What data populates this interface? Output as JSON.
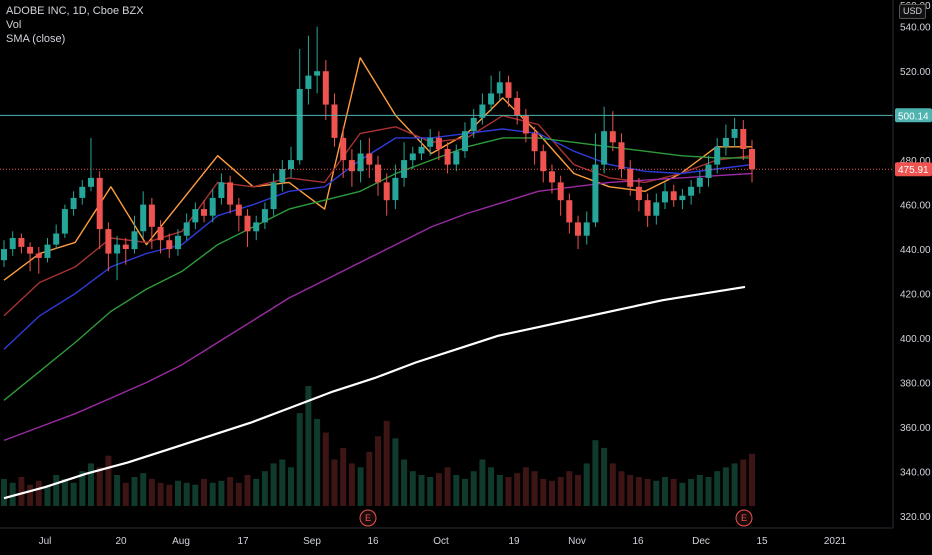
{
  "legend": {
    "symbol": "ADOBE INC, 1D, Cboe BZX",
    "vol": "Vol",
    "sma": "SMA (close)"
  },
  "currency_badge": "USD",
  "colors": {
    "background": "#000000",
    "up": "#26a69a",
    "down": "#ef5350",
    "sma_fast": "#ff9e3d",
    "sma_mid": "#a83232",
    "sma_blue": "#2f3bd8",
    "sma_green": "#2e9b3a",
    "sma_purple": "#9b2aa3",
    "sma_slow": "#ffffff",
    "hline": "#4fb4b0"
  },
  "chart_data": {
    "type": "candlestick",
    "title": "ADOBE INC, 1D, Cboe BZX",
    "xlabel": "",
    "ylabel": "",
    "ylim": [
      311,
      552
    ],
    "y_ticks": [
      320,
      340,
      360,
      380,
      400,
      420,
      440,
      460,
      480,
      500,
      520,
      540
    ],
    "x_ticks": [
      "Jul",
      "20",
      "Aug",
      "17",
      "Sep",
      "16",
      "Oct",
      "19",
      "Nov",
      "16",
      "Dec",
      "15",
      "2021"
    ],
    "grid": false,
    "horizontal_line": 500.14,
    "price_labels": [
      {
        "value": 500.14,
        "text": "500.14",
        "color": "#4fb4b0"
      },
      {
        "value": 475.91,
        "text": "475.91",
        "color": "#ef5350"
      }
    ],
    "top_cut_label": "560.00",
    "earnings_markers": [
      {
        "label": "E",
        "date": "Sep 15"
      },
      {
        "label": "E",
        "date": "Dec 10"
      }
    ],
    "candles": [
      [
        435,
        440,
        444,
        432
      ],
      [
        440,
        445,
        448,
        437
      ],
      [
        445,
        441,
        447,
        438
      ],
      [
        441,
        438,
        443,
        430
      ],
      [
        438,
        436,
        441,
        429
      ],
      [
        436,
        442,
        445,
        434
      ],
      [
        442,
        447,
        451,
        440
      ],
      [
        447,
        458,
        460,
        445
      ],
      [
        458,
        463,
        466,
        455
      ],
      [
        463,
        468,
        471,
        460
      ],
      [
        468,
        472,
        490,
        466
      ],
      [
        472,
        449,
        475,
        440
      ],
      [
        449,
        438,
        452,
        430
      ],
      [
        438,
        442,
        446,
        426
      ],
      [
        442,
        440,
        445,
        433
      ],
      [
        440,
        448,
        455,
        438
      ],
      [
        448,
        460,
        466,
        445
      ],
      [
        460,
        450,
        463,
        440
      ],
      [
        450,
        444,
        453,
        438
      ],
      [
        444,
        440,
        447,
        436
      ],
      [
        440,
        446,
        449,
        437
      ],
      [
        446,
        452,
        456,
        444
      ],
      [
        452,
        458,
        461,
        449
      ],
      [
        458,
        455,
        462,
        452
      ],
      [
        455,
        463,
        467,
        452
      ],
      [
        463,
        470,
        474,
        460
      ],
      [
        470,
        460,
        473,
        456
      ],
      [
        460,
        455,
        463,
        448
      ],
      [
        455,
        448,
        458,
        441
      ],
      [
        448,
        452,
        455,
        444
      ],
      [
        452,
        458,
        461,
        449
      ],
      [
        458,
        470,
        474,
        455
      ],
      [
        470,
        476,
        480,
        466
      ],
      [
        476,
        480,
        486,
        472
      ],
      [
        480,
        512,
        530,
        478
      ],
      [
        512,
        518,
        536,
        505
      ],
      [
        518,
        520,
        540,
        510
      ],
      [
        520,
        505,
        525,
        498
      ],
      [
        505,
        490,
        510,
        486
      ],
      [
        490,
        480,
        495,
        472
      ],
      [
        480,
        475,
        485,
        468
      ],
      [
        475,
        483,
        489,
        470
      ],
      [
        483,
        478,
        490,
        472
      ],
      [
        478,
        470,
        482,
        464
      ],
      [
        470,
        462,
        474,
        455
      ],
      [
        462,
        472,
        478,
        458
      ],
      [
        472,
        480,
        488,
        468
      ],
      [
        480,
        483,
        486,
        476
      ],
      [
        483,
        486,
        490,
        480
      ],
      [
        486,
        490,
        494,
        482
      ],
      [
        490,
        485,
        493,
        480
      ],
      [
        485,
        478,
        488,
        474
      ],
      [
        478,
        484,
        487,
        475
      ],
      [
        484,
        493,
        497,
        481
      ],
      [
        493,
        499,
        503,
        490
      ],
      [
        499,
        505,
        510,
        496
      ],
      [
        505,
        510,
        518,
        502
      ],
      [
        510,
        515,
        520,
        507
      ],
      [
        515,
        508,
        518,
        504
      ],
      [
        508,
        500,
        511,
        496
      ],
      [
        500,
        492,
        503,
        488
      ],
      [
        492,
        484,
        495,
        478
      ],
      [
        484,
        475,
        487,
        470
      ],
      [
        475,
        470,
        478,
        465
      ],
      [
        470,
        462,
        473,
        455
      ],
      [
        462,
        452,
        465,
        447
      ],
      [
        452,
        446,
        455,
        440
      ],
      [
        446,
        452,
        457,
        442
      ],
      [
        452,
        478,
        492,
        450
      ],
      [
        478,
        493,
        504,
        474
      ],
      [
        493,
        488,
        502,
        484
      ],
      [
        488,
        476,
        492,
        472
      ],
      [
        476,
        468,
        480,
        464
      ],
      [
        468,
        462,
        472,
        457
      ],
      [
        462,
        455,
        465,
        450
      ],
      [
        455,
        461,
        465,
        451
      ],
      [
        461,
        466,
        470,
        458
      ],
      [
        466,
        462,
        469,
        459
      ],
      [
        462,
        464,
        467,
        458
      ],
      [
        464,
        468,
        471,
        460
      ],
      [
        468,
        472,
        475,
        465
      ],
      [
        472,
        478,
        482,
        468
      ],
      [
        478,
        486,
        490,
        474
      ],
      [
        486,
        490,
        496,
        482
      ],
      [
        490,
        494,
        499,
        486
      ],
      [
        494,
        485,
        498,
        480
      ],
      [
        485,
        475.91,
        489,
        470
      ]
    ],
    "volume": [
      14,
      12,
      15,
      11,
      13,
      10,
      16,
      14,
      12,
      18,
      22,
      20,
      26,
      16,
      12,
      15,
      17,
      14,
      12,
      11,
      13,
      12,
      11,
      14,
      12,
      13,
      15,
      12,
      16,
      14,
      18,
      22,
      24,
      20,
      48,
      62,
      45,
      38,
      24,
      30,
      22,
      20,
      28,
      36,
      44,
      35,
      24,
      18,
      16,
      15,
      17,
      20,
      16,
      14,
      18,
      24,
      20,
      16,
      15,
      17,
      20,
      18,
      14,
      13,
      15,
      18,
      16,
      22,
      34,
      30,
      22,
      18,
      16,
      15,
      14,
      13,
      15,
      14,
      12,
      14,
      16,
      15,
      18,
      20,
      22,
      24,
      27
    ],
    "series": [
      {
        "name": "SMA (close)",
        "period": 5,
        "color": "#ff9e3d",
        "values": [
          426,
          438,
          443,
          468,
          442,
          462,
          482,
          468,
          470,
          458,
          526,
          500,
          483,
          492,
          508,
          492,
          474,
          468,
          466,
          474,
          486,
          486
        ]
      },
      {
        "name": "SMA (close)",
        "period": 10,
        "color": "#a83232",
        "values": [
          410,
          425,
          432,
          445,
          443,
          448,
          470,
          468,
          472,
          470,
          492,
          495,
          488,
          490,
          500,
          496,
          478,
          472,
          470,
          474,
          480,
          482
        ]
      },
      {
        "name": "SMA (close)",
        "period": 20,
        "color": "#2f3bd8",
        "values": [
          395,
          410,
          420,
          432,
          438,
          442,
          455,
          460,
          466,
          468,
          480,
          490,
          490,
          492,
          494,
          492,
          484,
          478,
          475,
          474,
          476,
          478
        ]
      },
      {
        "name": "SMA (close)",
        "period": 50,
        "color": "#2e9b3a",
        "values": [
          372,
          385,
          398,
          412,
          422,
          430,
          442,
          450,
          458,
          462,
          466,
          474,
          480,
          486,
          490,
          490,
          488,
          486,
          484,
          482,
          481,
          481
        ]
      },
      {
        "name": "SMA (close)",
        "period": 100,
        "color": "#9b2aa3",
        "values": [
          354,
          360,
          366,
          373,
          380,
          388,
          398,
          408,
          418,
          426,
          434,
          442,
          450,
          456,
          461,
          466,
          468,
          470,
          471,
          472,
          473,
          474
        ]
      },
      {
        "name": "SMA (close)",
        "period": 200,
        "color": "#ffffff",
        "values": [
          328,
          333,
          339,
          344,
          350,
          356,
          362,
          369,
          376,
          382,
          389,
          395,
          401,
          405,
          409,
          413,
          417,
          420,
          423
        ]
      }
    ]
  }
}
